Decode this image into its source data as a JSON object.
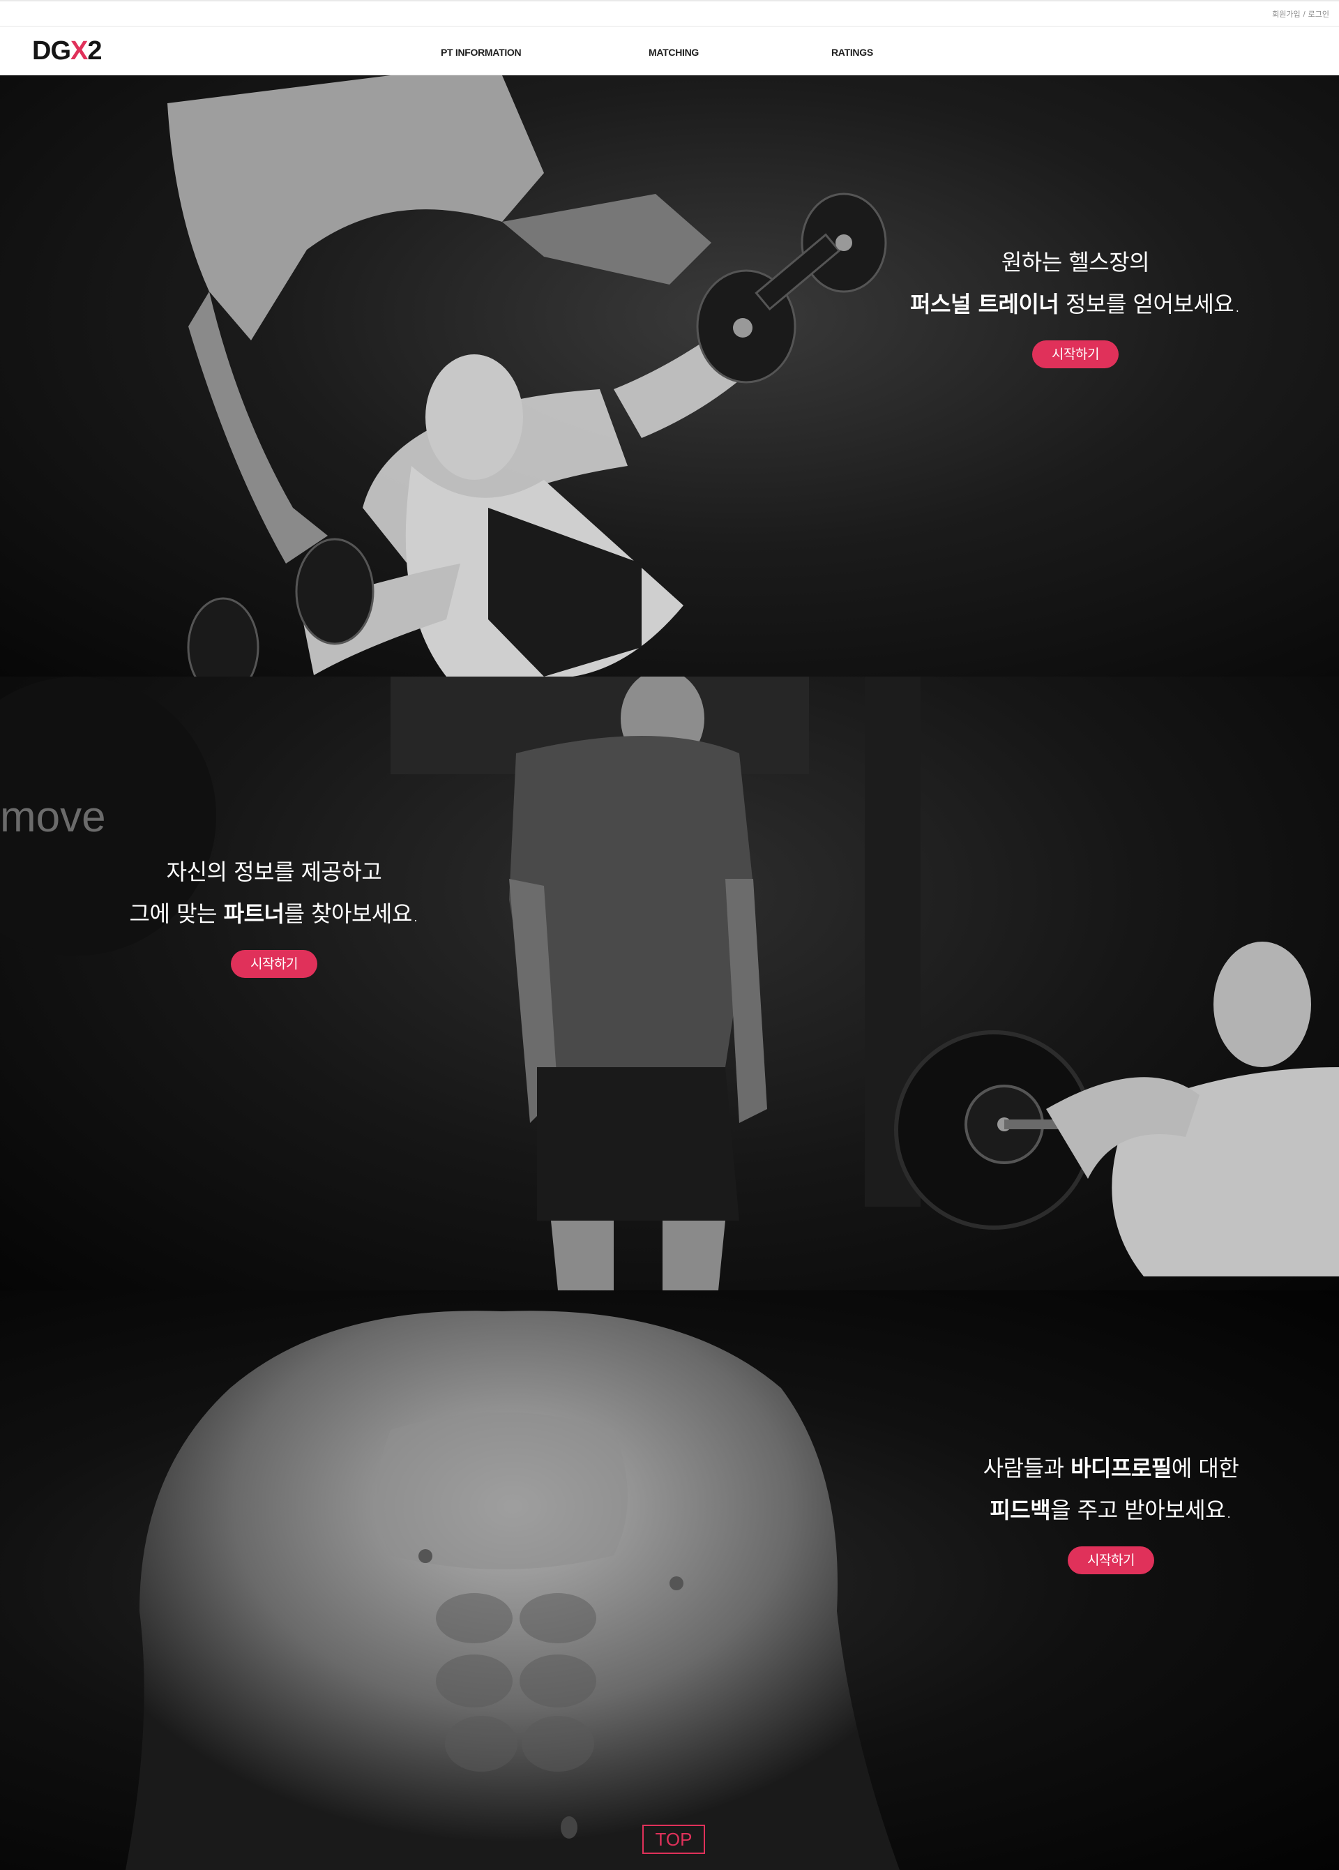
{
  "utility": {
    "signup": "회원가입",
    "separator": "/",
    "login": "로그인"
  },
  "logo": {
    "part1": "DG",
    "part2": "X",
    "part3": "2"
  },
  "nav": {
    "pt_information": "PT INFORMATION",
    "matching": "MATCHING",
    "ratings": "RATINGS"
  },
  "sections": [
    {
      "line1": "원하는 헬스장의",
      "line2_bold": "퍼스널 트레이너",
      "line2_rest": " 정보를 얻어보세요.",
      "button": "시작하기",
      "photo": "woman doing dumbbell fly on bench with trainer spotting"
    },
    {
      "line1": "자신의 정보를 제공하고",
      "line2_pre": "그에 맞는 ",
      "line2_bold": "파트너",
      "line2_rest": "를 찾아보세요.",
      "button": "시작하기",
      "photo": "trainer standing in gym and woman lifting barbell"
    },
    {
      "line1_pre": "사람들과 ",
      "line1_bold": "바디프로필",
      "line1_rest": "에 대한",
      "line2_bold": "피드백",
      "line2_rest": "을 주고 받아보세요.",
      "button": "시작하기",
      "photo": "muscular male torso"
    }
  ],
  "top_button": "TOP",
  "colors": {
    "accent": "#e0315a",
    "background": "#000000",
    "nav_bg": "#ffffff"
  }
}
